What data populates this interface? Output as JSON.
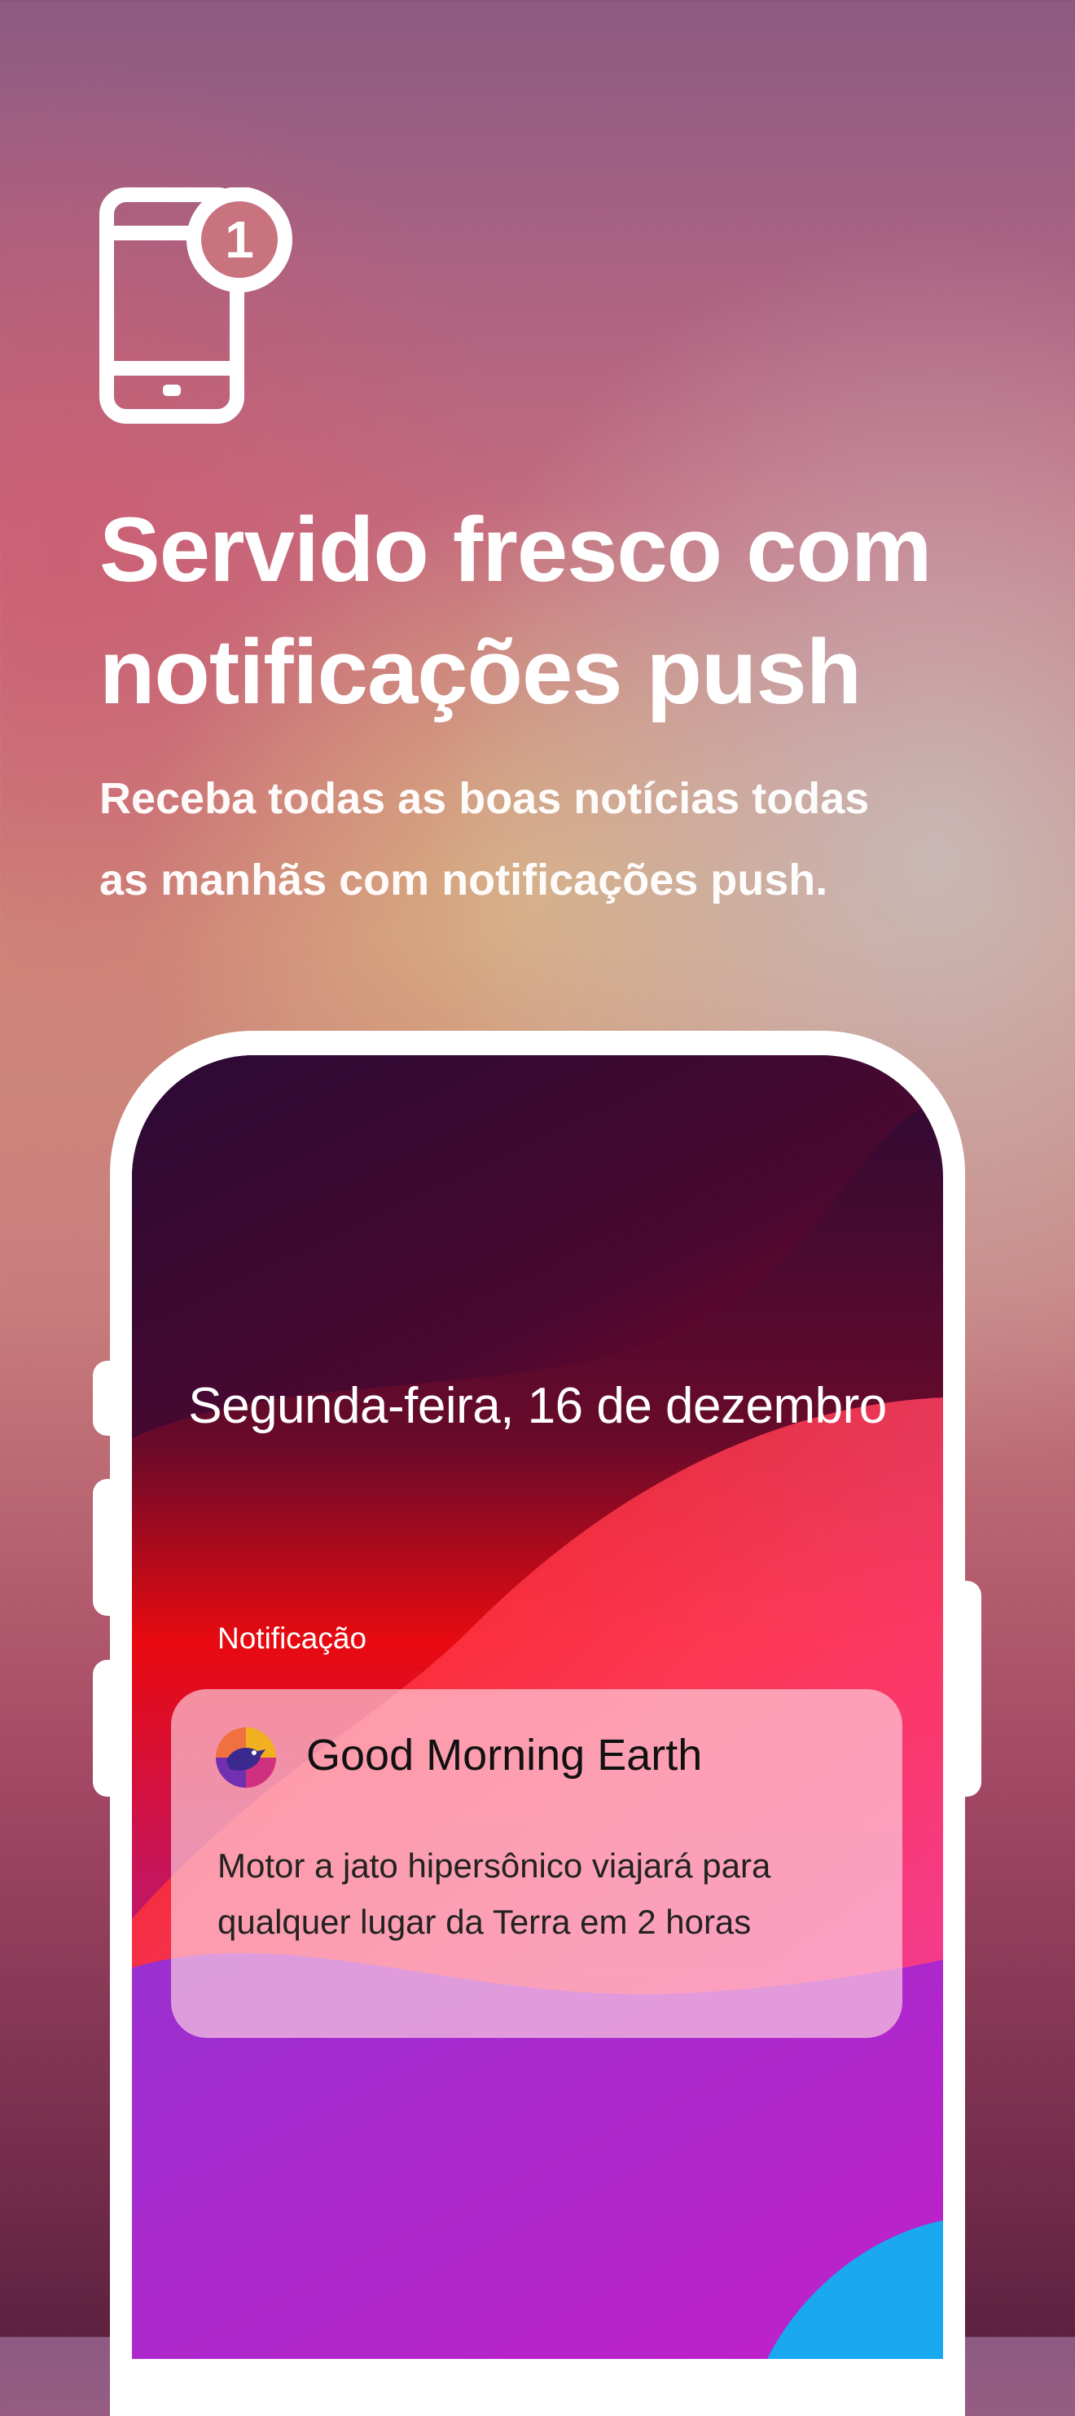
{
  "hero": {
    "icon": "phone-notification-icon",
    "badge_count": "1",
    "title": "Servido fresco com notificações push",
    "subtitle": "Receba todas as boas notícias todas as manhãs com notificações push."
  },
  "lock_screen": {
    "date": "Segunda-feira, 16 de dezembro",
    "notification_section_label": "Notificação",
    "notification": {
      "app_icon": "earth-bird-app-icon",
      "app_name": "Good Morning Earth",
      "message": "Motor a jato hipersônico viajará para qualquer lugar da Terra em 2 horas"
    }
  },
  "colors": {
    "text": "#ffffff",
    "card": "#ffd4e2",
    "wallpaper_dark": "#2a0a35",
    "wallpaper_red": "#e80a10",
    "wallpaper_purple": "#8a1ec8"
  }
}
